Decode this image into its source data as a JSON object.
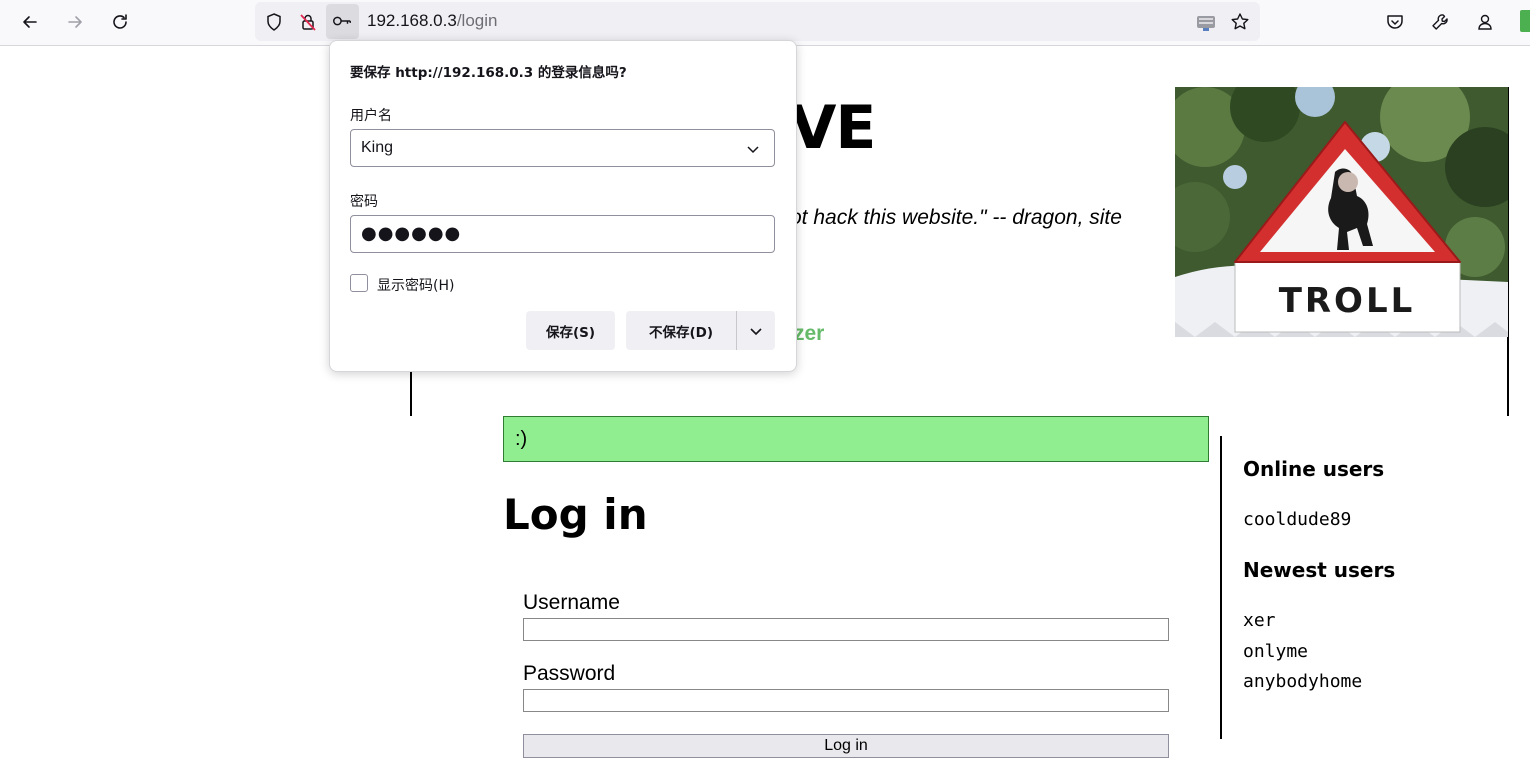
{
  "browser": {
    "url_host": "192.168.0.3",
    "url_path": "/login"
  },
  "page": {
    "hero_fragment": "VE",
    "quote_fragment": "ot hack this website.\" -- dragon, site",
    "link_fragment": "zer",
    "troll_sign_text": "TROLL",
    "flash_message": ":)",
    "login_title": "Log in",
    "username_label": "Username",
    "password_label": "Password",
    "login_button": "Log in"
  },
  "sidebar": {
    "online_title": "Online users",
    "online_users": [
      "cooldude89"
    ],
    "newest_title": "Newest users",
    "newest_users": [
      "xer",
      "onlyme",
      "anybodyhome"
    ]
  },
  "password_popup": {
    "title": "要保存 http://192.168.0.3 的登录信息吗?",
    "username_label": "用户名",
    "username_value": "King",
    "password_label": "密码",
    "password_masked": "●●●●●●",
    "show_password_label": "显示密码(H)",
    "save_button": "保存(S)",
    "dont_save_button": "不保存(D)"
  },
  "colors": {
    "flash_bg": "#90ee90",
    "link_green": "#66bb6a",
    "troll_red": "#d32f2f"
  }
}
